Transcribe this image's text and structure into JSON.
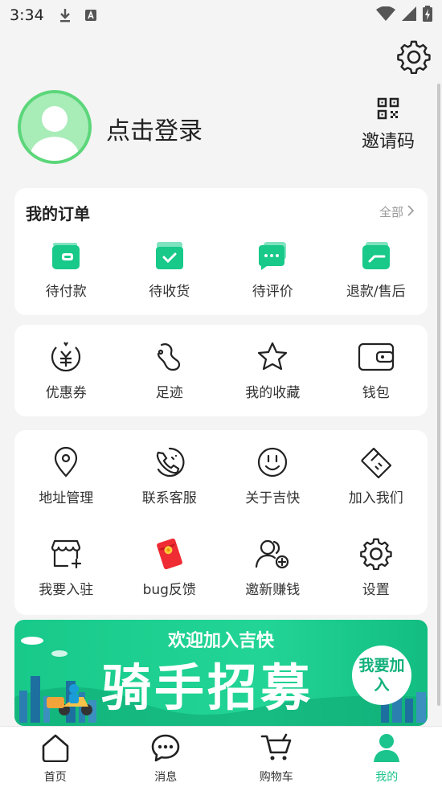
{
  "status_bar": {
    "time": "3:34"
  },
  "profile": {
    "login_label": "点击登录",
    "invite_label": "邀请码"
  },
  "orders": {
    "title": "我的订单",
    "all_label": "全部",
    "items": [
      {
        "label": "待付款",
        "icon": "wallet-icon"
      },
      {
        "label": "待收货",
        "icon": "package-check-icon"
      },
      {
        "label": "待评价",
        "icon": "comment-icon"
      },
      {
        "label": "退款/售后",
        "icon": "refund-icon"
      }
    ]
  },
  "tools_row1": [
    {
      "label": "优惠券",
      "icon": "coupon-icon"
    },
    {
      "label": "足迹",
      "icon": "footprint-icon"
    },
    {
      "label": "我的收藏",
      "icon": "star-icon"
    },
    {
      "label": "钱包",
      "icon": "wallet-outline-icon"
    }
  ],
  "tools_row2": [
    {
      "label": "地址管理",
      "icon": "location-icon"
    },
    {
      "label": "联系客服",
      "icon": "phone-icon"
    },
    {
      "label": "关于吉快",
      "icon": "smile-icon"
    },
    {
      "label": "加入我们",
      "icon": "handshake-icon"
    }
  ],
  "tools_row3": [
    {
      "label": "我要入驻",
      "icon": "store-icon"
    },
    {
      "label": "bug反馈",
      "icon": "red-envelope-icon"
    },
    {
      "label": "邀新赚钱",
      "icon": "invite-user-icon"
    },
    {
      "label": "设置",
      "icon": "gear-icon"
    }
  ],
  "banner": {
    "subtitle": "欢迎加入吉快",
    "headline": "骑手招募",
    "cta": "我要加入"
  },
  "tabbar": {
    "items": [
      {
        "label": "首页",
        "icon": "home-icon"
      },
      {
        "label": "消息",
        "icon": "message-icon"
      },
      {
        "label": "购物车",
        "icon": "cart-icon"
      },
      {
        "label": "我的",
        "icon": "user-icon"
      }
    ],
    "active_index": 3
  },
  "colors": {
    "accent": "#1bc48c",
    "avatar_ring": "#5cd67a"
  }
}
